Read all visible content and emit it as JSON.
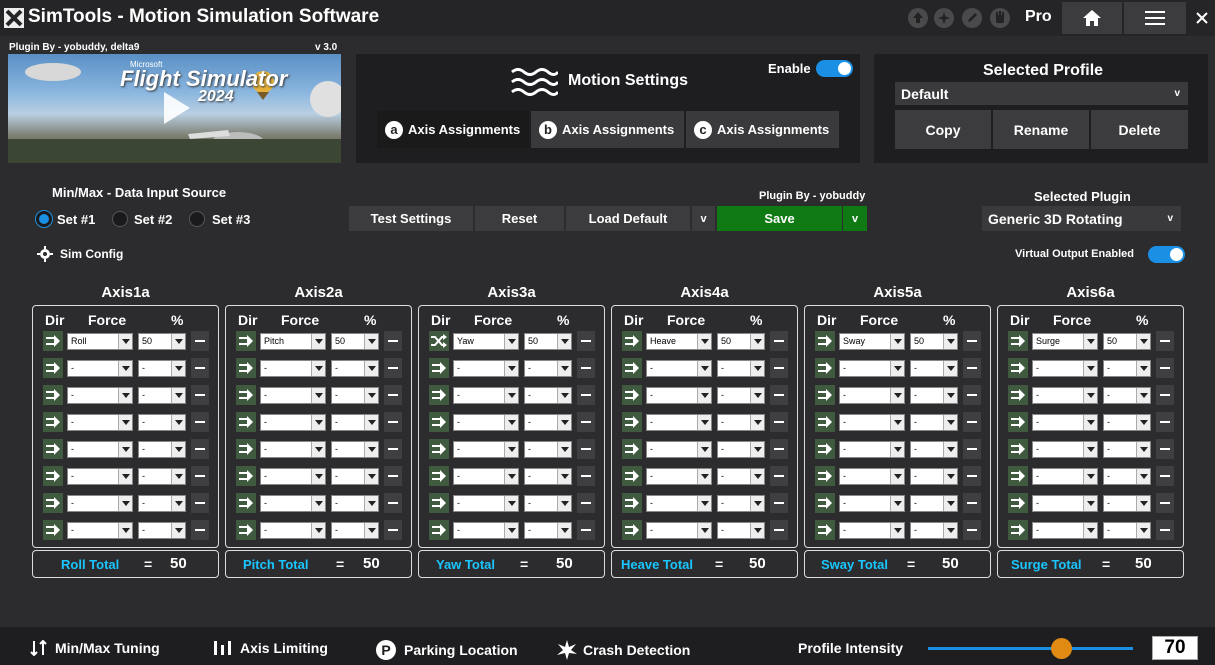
{
  "app": {
    "title": "SimTools - Motion Simulation Software",
    "edition": "Pro"
  },
  "banner": {
    "plugin_by": "Plugin By - yobuddy, delta9",
    "version": "v 3.0",
    "brand": "Microsoft",
    "game_title": "Flight Simulator",
    "year": "2024"
  },
  "motion": {
    "title": "Motion Settings",
    "enable_label": "Enable",
    "enabled": true,
    "tabs": [
      {
        "badge": "a",
        "label": "Axis Assignments"
      },
      {
        "badge": "b",
        "label": "Axis Assignments"
      },
      {
        "badge": "c",
        "label": "Axis Assignments"
      }
    ]
  },
  "profile": {
    "title": "Selected Profile",
    "value": "Default",
    "copy": "Copy",
    "rename": "Rename",
    "delete": "Delete"
  },
  "input_source": {
    "title": "Min/Max - Data Input Source",
    "options": [
      "Set #1",
      "Set #2",
      "Set #3"
    ],
    "selected": "Set #1"
  },
  "actions": {
    "test": "Test Settings",
    "reset": "Reset",
    "load_default": "Load Default",
    "plugin_by": "Plugin By - yobuddy",
    "save": "Save",
    "chev": "v"
  },
  "plugin": {
    "title": "Selected Plugin",
    "value": "Generic 3D Rotating",
    "virtual_output": "Virtual Output Enabled",
    "virtual_on": true
  },
  "sim_config": "Sim Config",
  "columns": {
    "dir": "Dir",
    "force": "Force",
    "pct": "%"
  },
  "axes": [
    {
      "name": "Axis1a",
      "force": "Roll",
      "pct": "50",
      "total_label": "Roll Total",
      "total": "50",
      "first_dir": "arrow"
    },
    {
      "name": "Axis2a",
      "force": "Pitch",
      "pct": "50",
      "total_label": "Pitch Total",
      "total": "50",
      "first_dir": "arrow"
    },
    {
      "name": "Axis3a",
      "force": "Yaw",
      "pct": "50",
      "total_label": "Yaw Total",
      "total": "50",
      "first_dir": "shuffle"
    },
    {
      "name": "Axis4a",
      "force": "Heave",
      "pct": "50",
      "total_label": "Heave Total",
      "total": "50",
      "first_dir": "arrow"
    },
    {
      "name": "Axis5a",
      "force": "Sway",
      "pct": "50",
      "total_label": "Sway Total",
      "total": "50",
      "first_dir": "arrow"
    },
    {
      "name": "Axis6a",
      "force": "Surge",
      "pct": "50",
      "total_label": "Surge Total",
      "total": "50",
      "first_dir": "arrow"
    }
  ],
  "empty_value": "-",
  "total_eq": "=",
  "bottom": {
    "minmax": "Min/Max Tuning",
    "axis_limiting": "Axis Limiting",
    "parking": "Parking Location",
    "crash": "Crash Detection",
    "intensity_label": "Profile Intensity",
    "intensity": "70",
    "intensity_fraction": 0.7
  }
}
